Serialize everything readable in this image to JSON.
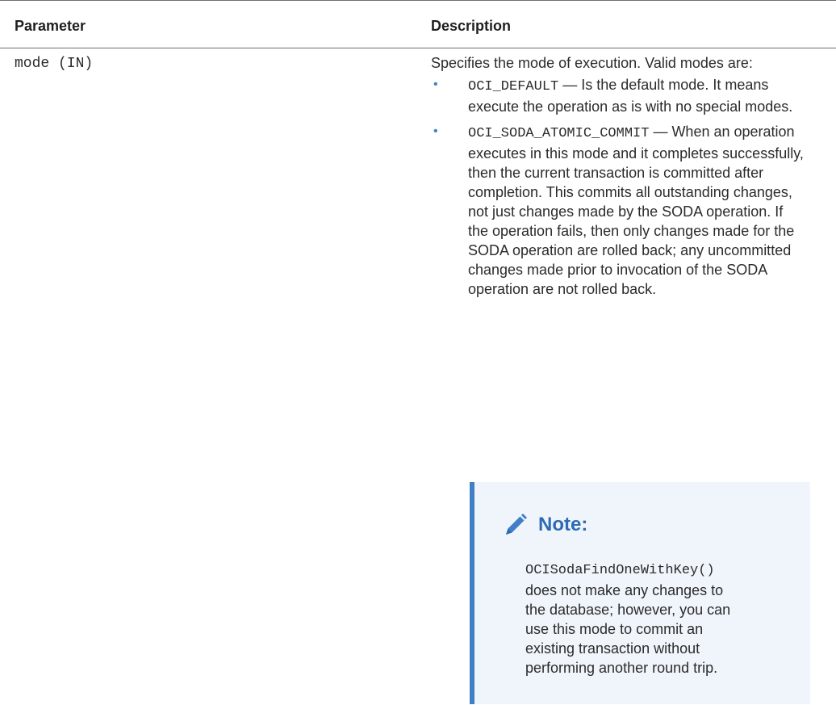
{
  "table": {
    "headers": {
      "parameter": "Parameter",
      "description": "Description"
    },
    "row": {
      "parameter": "mode (IN)",
      "description_intro": "Specifies the mode of execution. Valid modes are:",
      "modes": [
        {
          "code": "OCI_DEFAULT",
          "text": " — Is the default mode. It means execute the operation as is with no special modes."
        },
        {
          "code": "OCI_SODA_ATOMIC_COMMIT",
          "text": " — When an operation executes in this mode and it completes successfully, then the current transaction is committed after completion. This commits all outstanding changes, not just changes made by the SODA operation. If the operation fails, then only changes made for the SODA operation are rolled back; any uncommitted changes made prior to invocation of the SODA operation are not rolled back."
        }
      ],
      "note": {
        "icon": "pencil-icon",
        "title": "Note:",
        "code": "OCISodaFindOneWithKey()",
        "text": " does not make any changes to the database; however, you can use this mode to commit an existing transaction without performing another round trip."
      }
    }
  },
  "colors": {
    "accent": "#3f7fc6",
    "note_title": "#2d6bb5",
    "note_background": "#f0f5fb",
    "text": "#2b2b2b",
    "rule": "#6f6f6f"
  }
}
